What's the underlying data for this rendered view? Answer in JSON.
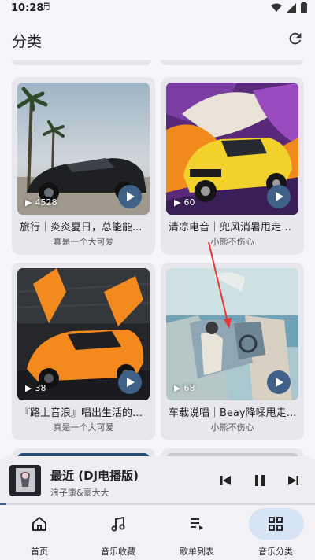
{
  "status": {
    "time": "10:28",
    "note": "♬"
  },
  "header": {
    "title": "分类"
  },
  "playlists": [
    {
      "title": "旅行｜炎炎夏日，总能能...",
      "author": "真是一个大可爱",
      "plays": "4528"
    },
    {
      "title": "清凉电音｜兜风消暑甩走炎...",
      "author": "小熊不伤心",
      "plays": "60"
    },
    {
      "title": "『路上音浪』唱出生活的无...",
      "author": "真是一个大可爱",
      "plays": "38"
    },
    {
      "title": "车载说唱｜Beay降噪甩走烦恼",
      "author": "小熊不伤心",
      "plays": "68"
    }
  ],
  "now_playing": {
    "title": "最近 (DJ电播版)",
    "artist": "浪子康&豪大大",
    "progress_fraction": 0.02
  },
  "nav": {
    "items": [
      {
        "label": "首页",
        "icon": "home-icon",
        "active": false
      },
      {
        "label": "音乐收藏",
        "icon": "music-note-icon",
        "active": false
      },
      {
        "label": "歌单列表",
        "icon": "playlist-icon",
        "active": false
      },
      {
        "label": "音乐分类",
        "icon": "grid-icon",
        "active": true
      }
    ]
  },
  "colors": {
    "accent": "#3f6188",
    "active_pill": "#d6e3f4",
    "annotation_arrow": "#e53935"
  }
}
